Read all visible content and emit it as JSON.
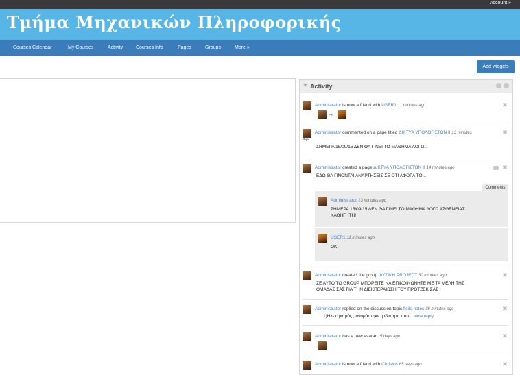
{
  "topbar": {
    "account_label": "Account »"
  },
  "header": {
    "site_title": "Τμήμα Μηχανικών Πληροφορικής"
  },
  "nav": {
    "items": [
      {
        "label": "Courses Calendar"
      },
      {
        "label": "My Courses"
      },
      {
        "label": "Activity"
      },
      {
        "label": "Courses Info"
      },
      {
        "label": "Pages"
      },
      {
        "label": "Groups"
      },
      {
        "label": "More »"
      }
    ]
  },
  "toolbar": {
    "add_widgets_label": "Add widgets"
  },
  "activity": {
    "title": "Activity",
    "items": [
      {
        "actor": "Administrator",
        "action": " is now a friend with ",
        "target": "USER1",
        "time": "11 minutes ago"
      },
      {
        "actor": "Administrator",
        "action": " commented on a page titled ",
        "target": "ΔΙΚΤΥΑ ΥΠΟΛΟΓΙΣΤΩΝ ΙΙ",
        "time": "13 minutes",
        "time2": "ago",
        "content": "ΣΗΜΕΡΑ 15/09/15 ΔΕΝ ΘΑ ΓΙΝΕΙ ΤΟ ΜΑΘΗΜΑ ΛΟΓΩ..."
      },
      {
        "actor": "Administrator",
        "action": " created a page ",
        "target": "ΔΙΚΤΥΑ ΥΠΟΛΟΓΙΣΤΩΝ ΙΙ",
        "time": "14 minutes ago",
        "content": "ΕΔΩ ΘΑ ΓΙΝΟΝΤΑΙ ΑΝΑΡΤΗΣΕΙΣ ΣΕ ΟΤΙ ΑΦΟΡΑ ΤΟ...",
        "comments_label": "Comments",
        "comments": [
          {
            "author": "Administrator",
            "time": "13 minutes ago",
            "text1": "ΣΗΜΕΡΑ 15/09/15 ΔΕΝ ΘΑ ΓΙΝΕΙ ΤΟ ΜΑΘΗΜΑ ΛΟΓΩ ΑΣΘΕΝΕΙΑΣ",
            "text2": "ΚΑΘΗΓΗΤΗ!"
          },
          {
            "author": "USER1",
            "time": "11 minutes ago",
            "text1": "OK!"
          }
        ]
      },
      {
        "actor": "Administrator",
        "action": " created the group ",
        "target": "ΦΥΣΙΚΗ PROJECT",
        "time": "30 minutes ago",
        "content1": "ΣΕ ΑΥΤΟ ΤΟ GROUP ΜΠΟΡΕΙΤΕ ΝΑ ΕΠΙΚΟΙΝΩΝΗΤΕ ΜΕ ΤΑ ΜΕΛΗ ΤΗΣ",
        "content2": "ΟΜΑΔΑΣ ΣΑΣ ΓΙΑ ΤΗΝ ΔΙΕΚΠΕΡΑΙΩΣΗ ΤΟΥ ΠΡΟΤΖΕΚ ΣΑΣ !"
      },
      {
        "actor": "Administrator",
        "action": " replied on the discussion topic ",
        "target": "fisiki notes",
        "time": "36 minutes ago",
        "content": "1)Ηλεκτρισμός , ονομάστηκε η ιδιότητα  που...",
        "reply_link": " view reply"
      },
      {
        "actor": "Administrator",
        "action": " has a new avatar",
        "time": "15 days ago"
      },
      {
        "actor": "Administrator",
        "action": " is now a friend with ",
        "target": "Christos",
        "time": "65 days ago"
      }
    ]
  }
}
